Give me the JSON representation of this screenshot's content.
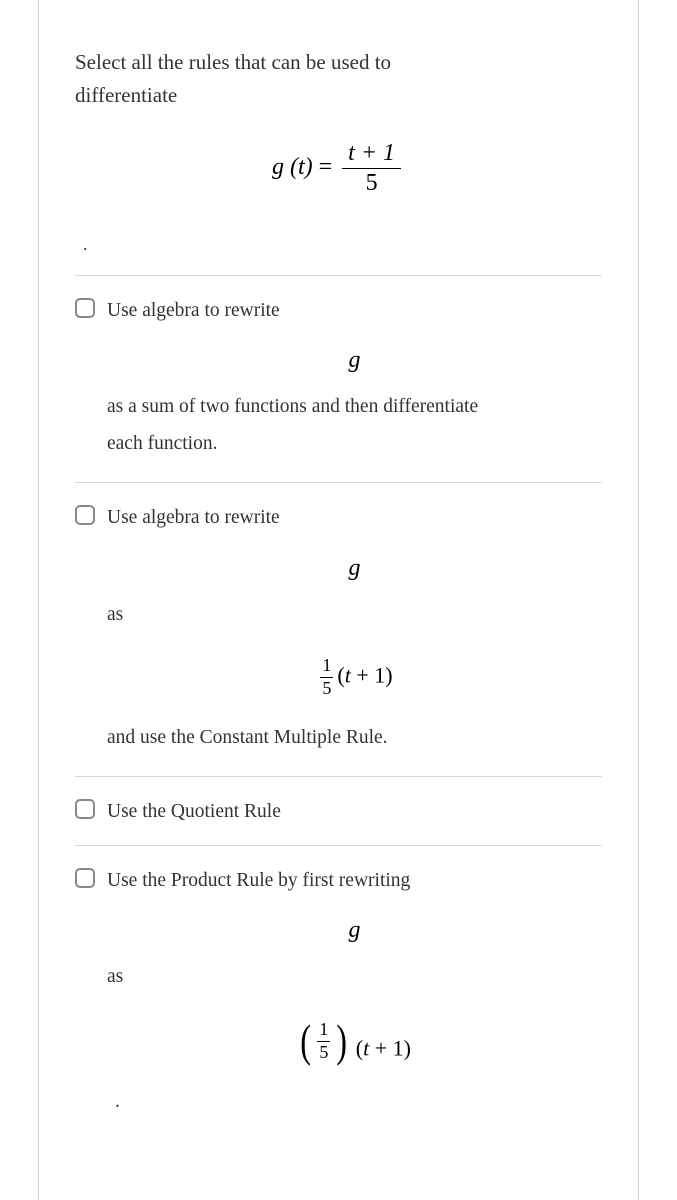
{
  "question": {
    "line1": "Select all the rules that can be used to",
    "line2": "differentiate"
  },
  "main_eq": {
    "lhs": "g (t)",
    "eq": " = ",
    "num": "t + 1",
    "den": "5"
  },
  "dot": ".",
  "options": {
    "a": {
      "lead": "Use algebra to rewrite",
      "g": "g",
      "tail1": "as a sum of two functions and then differentiate",
      "tail2": "each function."
    },
    "b": {
      "lead": "Use algebra to rewrite",
      "g": "g",
      "as": "as",
      "frac_num": "1",
      "frac_den": "5",
      "expr": "(t + 1)",
      "tail": "and use the Constant Multiple Rule."
    },
    "c": {
      "lead": "Use the Quotient Rule"
    },
    "d": {
      "lead": "Use the Product Rule by first rewriting",
      "g": "g",
      "as": "as",
      "frac_num": "1",
      "frac_den": "5",
      "expr": " (t + 1)",
      "dot": "."
    }
  }
}
